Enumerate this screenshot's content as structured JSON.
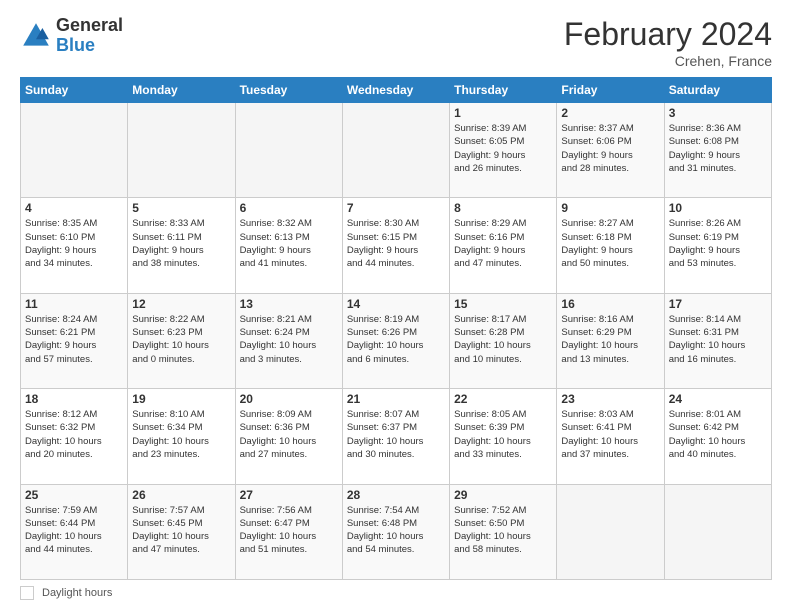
{
  "header": {
    "logo_general": "General",
    "logo_blue": "Blue",
    "month_title": "February 2024",
    "location": "Crehen, France"
  },
  "footer": {
    "daylight_label": "Daylight hours"
  },
  "weekdays": [
    "Sunday",
    "Monday",
    "Tuesday",
    "Wednesday",
    "Thursday",
    "Friday",
    "Saturday"
  ],
  "weeks": [
    [
      {
        "day": "",
        "info": ""
      },
      {
        "day": "",
        "info": ""
      },
      {
        "day": "",
        "info": ""
      },
      {
        "day": "",
        "info": ""
      },
      {
        "day": "1",
        "info": "Sunrise: 8:39 AM\nSunset: 6:05 PM\nDaylight: 9 hours\nand 26 minutes."
      },
      {
        "day": "2",
        "info": "Sunrise: 8:37 AM\nSunset: 6:06 PM\nDaylight: 9 hours\nand 28 minutes."
      },
      {
        "day": "3",
        "info": "Sunrise: 8:36 AM\nSunset: 6:08 PM\nDaylight: 9 hours\nand 31 minutes."
      }
    ],
    [
      {
        "day": "4",
        "info": "Sunrise: 8:35 AM\nSunset: 6:10 PM\nDaylight: 9 hours\nand 34 minutes."
      },
      {
        "day": "5",
        "info": "Sunrise: 8:33 AM\nSunset: 6:11 PM\nDaylight: 9 hours\nand 38 minutes."
      },
      {
        "day": "6",
        "info": "Sunrise: 8:32 AM\nSunset: 6:13 PM\nDaylight: 9 hours\nand 41 minutes."
      },
      {
        "day": "7",
        "info": "Sunrise: 8:30 AM\nSunset: 6:15 PM\nDaylight: 9 hours\nand 44 minutes."
      },
      {
        "day": "8",
        "info": "Sunrise: 8:29 AM\nSunset: 6:16 PM\nDaylight: 9 hours\nand 47 minutes."
      },
      {
        "day": "9",
        "info": "Sunrise: 8:27 AM\nSunset: 6:18 PM\nDaylight: 9 hours\nand 50 minutes."
      },
      {
        "day": "10",
        "info": "Sunrise: 8:26 AM\nSunset: 6:19 PM\nDaylight: 9 hours\nand 53 minutes."
      }
    ],
    [
      {
        "day": "11",
        "info": "Sunrise: 8:24 AM\nSunset: 6:21 PM\nDaylight: 9 hours\nand 57 minutes."
      },
      {
        "day": "12",
        "info": "Sunrise: 8:22 AM\nSunset: 6:23 PM\nDaylight: 10 hours\nand 0 minutes."
      },
      {
        "day": "13",
        "info": "Sunrise: 8:21 AM\nSunset: 6:24 PM\nDaylight: 10 hours\nand 3 minutes."
      },
      {
        "day": "14",
        "info": "Sunrise: 8:19 AM\nSunset: 6:26 PM\nDaylight: 10 hours\nand 6 minutes."
      },
      {
        "day": "15",
        "info": "Sunrise: 8:17 AM\nSunset: 6:28 PM\nDaylight: 10 hours\nand 10 minutes."
      },
      {
        "day": "16",
        "info": "Sunrise: 8:16 AM\nSunset: 6:29 PM\nDaylight: 10 hours\nand 13 minutes."
      },
      {
        "day": "17",
        "info": "Sunrise: 8:14 AM\nSunset: 6:31 PM\nDaylight: 10 hours\nand 16 minutes."
      }
    ],
    [
      {
        "day": "18",
        "info": "Sunrise: 8:12 AM\nSunset: 6:32 PM\nDaylight: 10 hours\nand 20 minutes."
      },
      {
        "day": "19",
        "info": "Sunrise: 8:10 AM\nSunset: 6:34 PM\nDaylight: 10 hours\nand 23 minutes."
      },
      {
        "day": "20",
        "info": "Sunrise: 8:09 AM\nSunset: 6:36 PM\nDaylight: 10 hours\nand 27 minutes."
      },
      {
        "day": "21",
        "info": "Sunrise: 8:07 AM\nSunset: 6:37 PM\nDaylight: 10 hours\nand 30 minutes."
      },
      {
        "day": "22",
        "info": "Sunrise: 8:05 AM\nSunset: 6:39 PM\nDaylight: 10 hours\nand 33 minutes."
      },
      {
        "day": "23",
        "info": "Sunrise: 8:03 AM\nSunset: 6:41 PM\nDaylight: 10 hours\nand 37 minutes."
      },
      {
        "day": "24",
        "info": "Sunrise: 8:01 AM\nSunset: 6:42 PM\nDaylight: 10 hours\nand 40 minutes."
      }
    ],
    [
      {
        "day": "25",
        "info": "Sunrise: 7:59 AM\nSunset: 6:44 PM\nDaylight: 10 hours\nand 44 minutes."
      },
      {
        "day": "26",
        "info": "Sunrise: 7:57 AM\nSunset: 6:45 PM\nDaylight: 10 hours\nand 47 minutes."
      },
      {
        "day": "27",
        "info": "Sunrise: 7:56 AM\nSunset: 6:47 PM\nDaylight: 10 hours\nand 51 minutes."
      },
      {
        "day": "28",
        "info": "Sunrise: 7:54 AM\nSunset: 6:48 PM\nDaylight: 10 hours\nand 54 minutes."
      },
      {
        "day": "29",
        "info": "Sunrise: 7:52 AM\nSunset: 6:50 PM\nDaylight: 10 hours\nand 58 minutes."
      },
      {
        "day": "",
        "info": ""
      },
      {
        "day": "",
        "info": ""
      }
    ]
  ]
}
